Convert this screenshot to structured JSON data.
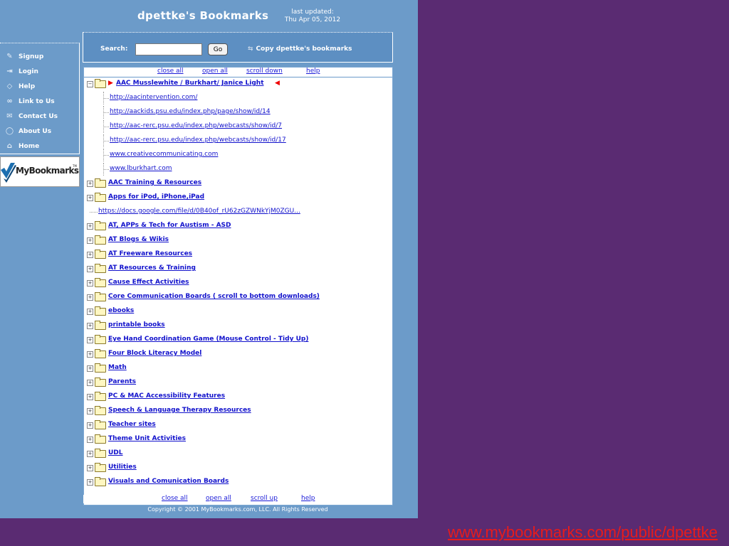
{
  "header": {
    "title": "dpettke's Bookmarks",
    "last_updated_label": "last updated:",
    "last_updated_date": "Thu Apr 05, 2012"
  },
  "search": {
    "label": "Search:",
    "value": "",
    "go_label": "Go",
    "copy_label": "Copy dpettke's bookmarks"
  },
  "sidebar": {
    "items": [
      {
        "label": "Signup",
        "icon": "pencil-icon"
      },
      {
        "label": "Login",
        "icon": "login-icon"
      },
      {
        "label": "Help",
        "icon": "help-icon"
      },
      {
        "label": "Link to Us",
        "icon": "link-icon"
      },
      {
        "label": "Contact Us",
        "icon": "mail-icon"
      },
      {
        "label": "About Us",
        "icon": "info-icon"
      },
      {
        "label": "Home",
        "icon": "home-icon"
      }
    ]
  },
  "logo": {
    "text": "MyBookmarks",
    "tm": "TM"
  },
  "top_links": {
    "close_all": "close all",
    "open_all": "open all",
    "scroll": "scroll down",
    "help": "help"
  },
  "bottom_links": {
    "close_all": "close all",
    "open_all": "open all",
    "scroll": "scroll up",
    "help": "help"
  },
  "tree": {
    "open_folder": "AAC Musslewhite / Burkhart/ Janice Light",
    "open_children": [
      "http://aacintervention.com/",
      "http://aackids.psu.edu/index.php/page/show/id/14",
      "http://aac-rerc.psu.edu/index.php/webcasts/show/id/7",
      "http://aac-rerc.psu.edu/index.php/webcasts/show/id/17",
      "www.creativecommunicating.com",
      "www.lburkhart.com"
    ],
    "folders_a": [
      "AAC Training & Resources",
      "Apps for iPod, iPhone,iPad"
    ],
    "standalone": "https://docs.google.com/file/d/0B40of_rU62zGZWNkYjM0ZGU...",
    "folders_b": [
      "AT, APPs & Tech for Austism - ASD",
      "AT Blogs & Wikis",
      "AT Freeware Resources",
      "AT Resources & Training",
      "Cause Effect Activities",
      "Core Communication Boards ( scroll to bottom downloads)",
      "ebooks",
      "printable books",
      "Eye Hand Coordination Game (Mouse Control - Tidy Up)",
      "Four Block Literacy Model",
      "Math",
      "Parents",
      "PC & MAC Accessibility Features",
      "Speech & Language Therapy Resources",
      "Teacher sites",
      "Theme Unit Activities",
      "UDL",
      "Utilities",
      "Visuals and Comunication Boards"
    ]
  },
  "copyright": "Copyright © 2001 MyBookmarks.com, LLC. All Rights Reserved",
  "footer_url": "www.mybookmarks.com/public/dpettke"
}
